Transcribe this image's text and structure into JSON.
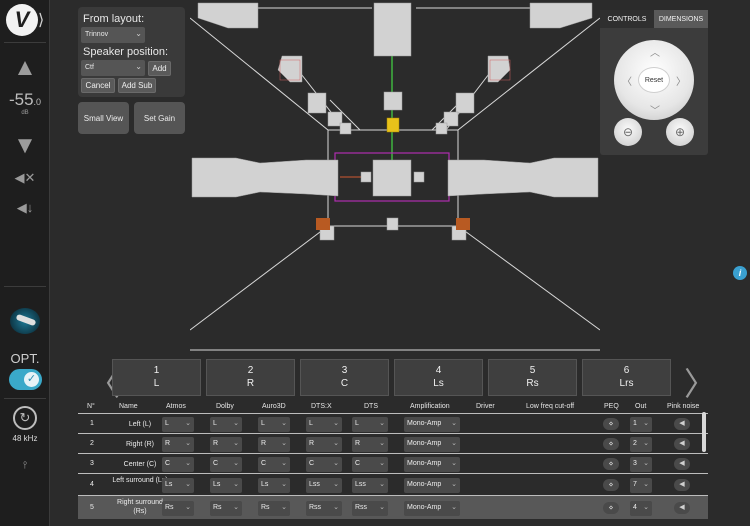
{
  "rail": {
    "logo": "V",
    "volume_value": "-55",
    "volume_decimal": ".0",
    "volume_unit": "dB",
    "opt_label": "OPT.",
    "sample_rate": "48 kHz"
  },
  "layout_panel": {
    "from_layout_label": "From layout:",
    "from_layout_value": "Trinnov",
    "speaker_position_label": "Speaker position:",
    "speaker_position_value": "Ctf",
    "add_label": "Add",
    "cancel_label": "Cancel",
    "add_sub_label": "Add Sub",
    "small_view_label": "Small View",
    "set_gain_label": "Set Gain"
  },
  "controls": {
    "tab_controls": "CONTROLS",
    "tab_dimensions": "DIMENSIONS",
    "reset_label": "Reset"
  },
  "channels": [
    {
      "num": "1",
      "code": "L"
    },
    {
      "num": "2",
      "code": "R"
    },
    {
      "num": "3",
      "code": "C"
    },
    {
      "num": "4",
      "code": "Ls"
    },
    {
      "num": "5",
      "code": "Rs"
    },
    {
      "num": "6",
      "code": "Lrs"
    }
  ],
  "table": {
    "headers": [
      "N°",
      "Name",
      "Atmos",
      "Dolby",
      "Auro3D",
      "DTS:X",
      "DTS",
      "Amplification",
      "Driver",
      "Low freq cut-off",
      "PEQ",
      "Out",
      "Pink noise"
    ],
    "rows": [
      {
        "n": "1",
        "name": "Left (L)",
        "atmos": "L",
        "dolby": "L",
        "auro": "L",
        "dtsx": "L",
        "dts": "L",
        "amp": "Mono-Amp",
        "out": "1"
      },
      {
        "n": "2",
        "name": "Right (R)",
        "atmos": "R",
        "dolby": "R",
        "auro": "R",
        "dtsx": "R",
        "dts": "R",
        "amp": "Mono-Amp",
        "out": "2"
      },
      {
        "n": "3",
        "name": "Center (C)",
        "atmos": "C",
        "dolby": "C",
        "auro": "C",
        "dtsx": "C",
        "dts": "C",
        "amp": "Mono-Amp",
        "out": "3"
      },
      {
        "n": "4",
        "name": "Left surround (Ls)",
        "atmos": "Ls",
        "dolby": "Ls",
        "auro": "Ls",
        "dtsx": "Lss",
        "dts": "Lss",
        "amp": "Mono-Amp",
        "out": "7"
      },
      {
        "n": "5",
        "name": "Right surround (Rs)",
        "atmos": "Rs",
        "dolby": "Rs",
        "auro": "Rs",
        "dtsx": "Rss",
        "dts": "Rss",
        "amp": "Mono-Amp",
        "out": "4"
      }
    ]
  },
  "colors": {
    "accent": "#3aa9c9",
    "speaker": "#d2d2d2",
    "selected_speaker": "#e8c21a",
    "sub": "#b85a22",
    "listening_area": "#b02db0"
  }
}
